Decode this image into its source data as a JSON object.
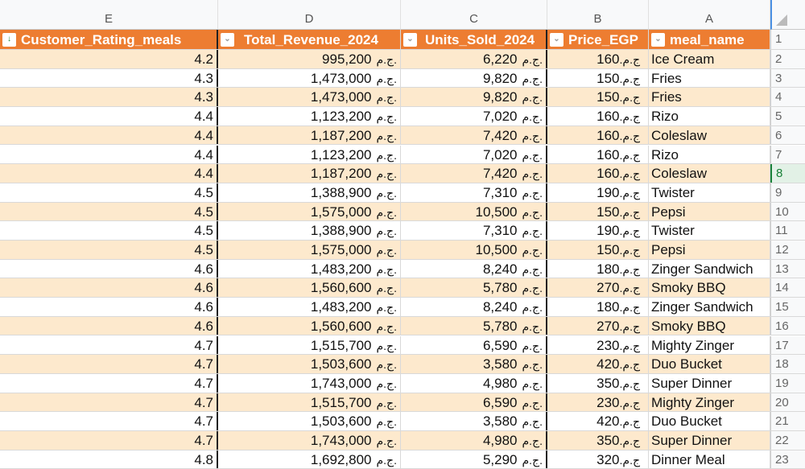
{
  "column_letters": [
    "E",
    "D",
    "C",
    "B",
    "A"
  ],
  "headers": {
    "rating": "Customer_Rating_meals",
    "revenue": "Total_Revenue_2024",
    "units": "Units_Sold_2024",
    "price": "Price_EGP",
    "meal": "meal_name"
  },
  "header_row_number": "1",
  "currency": "ج.م.",
  "selected_row": 8,
  "rows": [
    {
      "n": 2,
      "rating": "4.2",
      "revenue": "995,200",
      "units": "6,220",
      "price": "160",
      "meal": "Ice Cream"
    },
    {
      "n": 3,
      "rating": "4.3",
      "revenue": "1,473,000",
      "units": "9,820",
      "price": "150",
      "meal": "Fries"
    },
    {
      "n": 4,
      "rating": "4.3",
      "revenue": "1,473,000",
      "units": "9,820",
      "price": "150",
      "meal": "Fries"
    },
    {
      "n": 5,
      "rating": "4.4",
      "revenue": "1,123,200",
      "units": "7,020",
      "price": "160",
      "meal": "Rizo"
    },
    {
      "n": 6,
      "rating": "4.4",
      "revenue": "1,187,200",
      "units": "7,420",
      "price": "160",
      "meal": "Coleslaw"
    },
    {
      "n": 7,
      "rating": "4.4",
      "revenue": "1,123,200",
      "units": "7,020",
      "price": "160",
      "meal": "Rizo"
    },
    {
      "n": 8,
      "rating": "4.4",
      "revenue": "1,187,200",
      "units": "7,420",
      "price": "160",
      "meal": "Coleslaw"
    },
    {
      "n": 9,
      "rating": "4.5",
      "revenue": "1,388,900",
      "units": "7,310",
      "price": "190",
      "meal": "Twister"
    },
    {
      "n": 10,
      "rating": "4.5",
      "revenue": "1,575,000",
      "units": "10,500",
      "price": "150",
      "meal": "Pepsi"
    },
    {
      "n": 11,
      "rating": "4.5",
      "revenue": "1,388,900",
      "units": "7,310",
      "price": "190",
      "meal": "Twister"
    },
    {
      "n": 12,
      "rating": "4.5",
      "revenue": "1,575,000",
      "units": "10,500",
      "price": "150",
      "meal": "Pepsi"
    },
    {
      "n": 13,
      "rating": "4.6",
      "revenue": "1,483,200",
      "units": "8,240",
      "price": "180",
      "meal": "Zinger Sandwich"
    },
    {
      "n": 14,
      "rating": "4.6",
      "revenue": "1,560,600",
      "units": "5,780",
      "price": "270",
      "meal": "Smoky BBQ"
    },
    {
      "n": 15,
      "rating": "4.6",
      "revenue": "1,483,200",
      "units": "8,240",
      "price": "180",
      "meal": "Zinger Sandwich"
    },
    {
      "n": 16,
      "rating": "4.6",
      "revenue": "1,560,600",
      "units": "5,780",
      "price": "270",
      "meal": "Smoky BBQ"
    },
    {
      "n": 17,
      "rating": "4.7",
      "revenue": "1,515,700",
      "units": "6,590",
      "price": "230",
      "meal": "Mighty Zinger"
    },
    {
      "n": 18,
      "rating": "4.7",
      "revenue": "1,503,600",
      "units": "3,580",
      "price": "420",
      "meal": "Duo Bucket"
    },
    {
      "n": 19,
      "rating": "4.7",
      "revenue": "1,743,000",
      "units": "4,980",
      "price": "350",
      "meal": "Super Dinner"
    },
    {
      "n": 20,
      "rating": "4.7",
      "revenue": "1,515,700",
      "units": "6,590",
      "price": "230",
      "meal": "Mighty Zinger"
    },
    {
      "n": 21,
      "rating": "4.7",
      "revenue": "1,503,600",
      "units": "3,580",
      "price": "420",
      "meal": "Duo Bucket"
    },
    {
      "n": 22,
      "rating": "4.7",
      "revenue": "1,743,000",
      "units": "4,980",
      "price": "350",
      "meal": "Super Dinner"
    },
    {
      "n": 23,
      "rating": "4.8",
      "revenue": "1,692,800",
      "units": "5,290",
      "price": "320",
      "meal": "Dinner Meal"
    }
  ]
}
